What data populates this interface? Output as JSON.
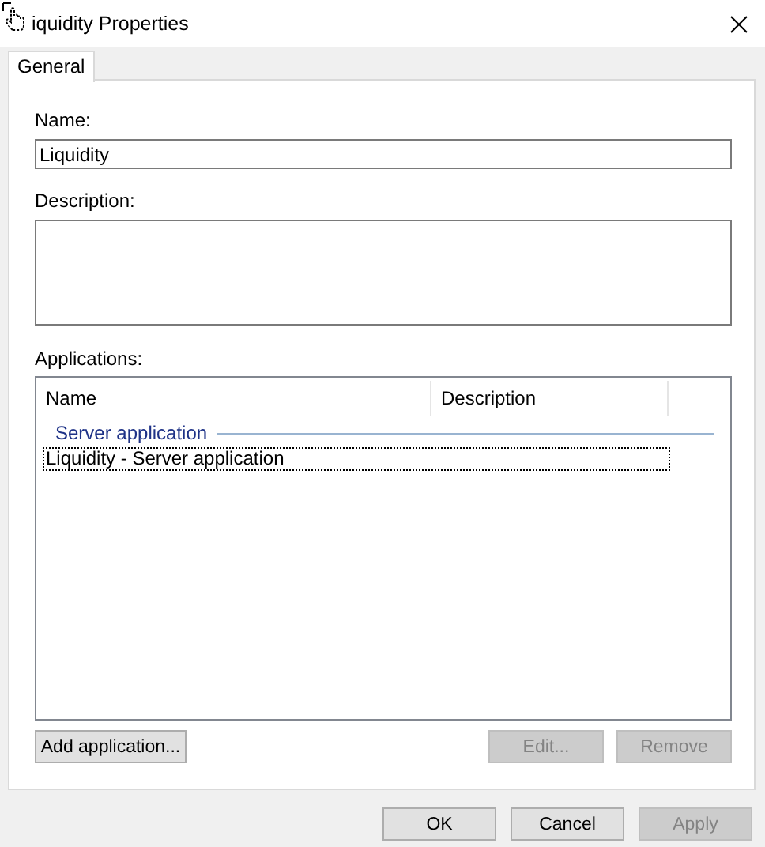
{
  "window": {
    "title": "iquidity Properties"
  },
  "tabs": [
    {
      "label": "General",
      "selected": true
    }
  ],
  "fields": [
    {
      "kind": "input",
      "label": "Name:",
      "value": "Liquidity"
    },
    {
      "kind": "textarea",
      "label": "Description:"
    }
  ],
  "applications": {
    "label": "Applications:",
    "columns": [
      "Name",
      "Description"
    ],
    "groups": [
      {
        "name": "Server application",
        "rows": [
          {
            "cells": [
              "Liquidity - Server application"
            ],
            "focused": true
          }
        ]
      }
    ]
  },
  "list_buttons": [
    {
      "label": "Add application...",
      "disabled": false
    },
    {
      "label": "Edit...",
      "disabled": true
    },
    {
      "label": "Remove",
      "disabled": true
    }
  ],
  "dialog_buttons": [
    {
      "label": "OK",
      "disabled": false
    },
    {
      "label": "Cancel",
      "disabled": false
    },
    {
      "label": "Apply",
      "disabled": true
    }
  ]
}
